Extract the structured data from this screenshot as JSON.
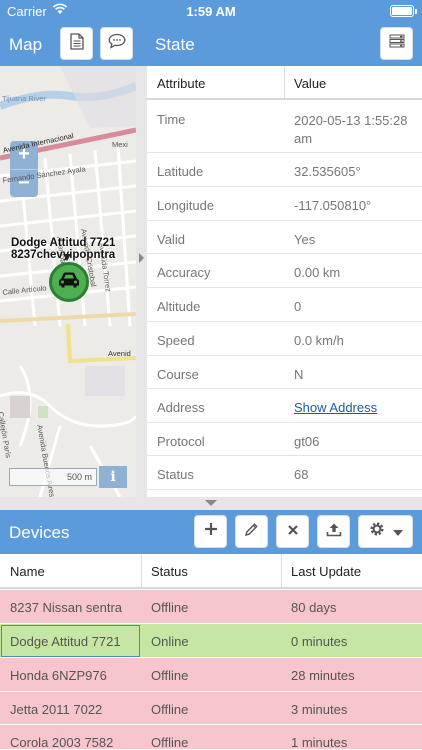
{
  "status_bar": {
    "carrier": "Carrier",
    "time": "1:59 AM"
  },
  "map_header": {
    "title": "Map"
  },
  "state_header": {
    "title": "State"
  },
  "map": {
    "zoom_in": "+",
    "zoom_out": "−",
    "labels": {
      "river": "Tijuana River",
      "avenida_internacional": "Avenida Internacional",
      "mexico": "Mexi",
      "fernando": "Fernando Sánchez Ayala",
      "cristobal": "Avenida Cristobal",
      "maria": "Avenida María",
      "torrez": "Avenida Torrez",
      "articulo": "Calle Artículo",
      "avenida_right": "Avenid",
      "callejon": "Callejón París",
      "buenos_aires": "Avenida Buenos Aires"
    },
    "device_label_line1": "Dodge Attitud 7721",
    "device_label_line2": "8237chevyipopntra",
    "scale": "500 m",
    "info": "i"
  },
  "state": {
    "columns": [
      "Attribute",
      "Value"
    ],
    "rows": [
      {
        "attr": "Time",
        "value": "2020-05-13 1:55:28 am"
      },
      {
        "attr": "Latitude",
        "value": "32.535605°"
      },
      {
        "attr": "Longitude",
        "value": "-117.050810°"
      },
      {
        "attr": "Valid",
        "value": "Yes"
      },
      {
        "attr": "Accuracy",
        "value": "0.00 km"
      },
      {
        "attr": "Altitude",
        "value": "0"
      },
      {
        "attr": "Speed",
        "value": "0.0 km/h"
      },
      {
        "attr": "Course",
        "value": "N"
      },
      {
        "attr": "Address",
        "value": "Show Address"
      },
      {
        "attr": "Protocol",
        "value": "gt06"
      },
      {
        "attr": "Status",
        "value": "68"
      }
    ]
  },
  "devices_header": {
    "title": "Devices"
  },
  "devices": {
    "columns": [
      "Name",
      "Status",
      "Last Update"
    ],
    "rows": [
      {
        "name": "8237 Nissan sentra",
        "status": "Offline",
        "last_update": "80 days"
      },
      {
        "name": "Dodge Attitud 7721",
        "status": "Online",
        "last_update": "0 minutes"
      },
      {
        "name": "Honda 6NZP976",
        "status": "Offline",
        "last_update": "28 minutes"
      },
      {
        "name": "Jetta 2011 7022",
        "status": "Offline",
        "last_update": "3 minutes"
      },
      {
        "name": "Corola 2003 7582",
        "status": "Offline",
        "last_update": "1 minutes"
      }
    ]
  },
  "colors": {
    "header_blue": "#5b9bdc",
    "offline_row": "#f7c6cc",
    "online_row": "#c6e7a4",
    "marker_green": "#4caf50"
  },
  "icons": [
    "wifi-icon",
    "battery-icon",
    "report-icon",
    "chat-icon",
    "menu-icon",
    "car-icon",
    "add-icon",
    "edit-icon",
    "delete-icon",
    "upload-icon",
    "gear-icon",
    "caret-down-icon"
  ]
}
